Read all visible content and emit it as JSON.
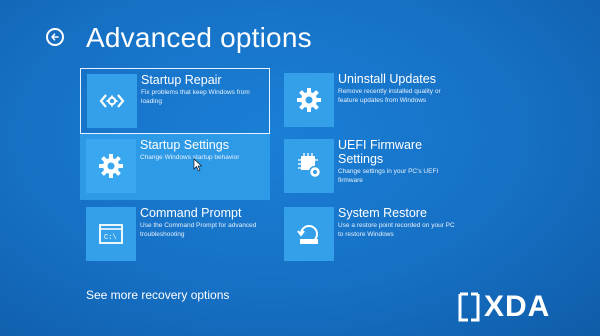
{
  "header": {
    "title": "Advanced options"
  },
  "options": [
    {
      "label": "Startup Repair",
      "desc": "Fix problems that keep Windows from loading",
      "icon": "code-brackets-icon"
    },
    {
      "label": "Uninstall Updates",
      "desc": "Remove recently installed quality or feature updates from Windows",
      "icon": "gear-icon"
    },
    {
      "label": "Startup Settings",
      "desc": "Change Windows startup behavior",
      "icon": "gear-icon"
    },
    {
      "label": "UEFI Firmware Settings",
      "desc": "Change settings in your PC's UEFI firmware",
      "icon": "chip-gear-icon"
    },
    {
      "label": "Command Prompt",
      "desc": "Use the Command Prompt for advanced troubleshooting",
      "icon": "terminal-icon"
    },
    {
      "label": "System Restore",
      "desc": "Use a restore point recorded on your PC to restore Windows",
      "icon": "restore-icon"
    }
  ],
  "footer": {
    "more_label": "See more recovery options"
  },
  "watermark": {
    "text": "XDA"
  },
  "colors": {
    "background": "#1670c4",
    "tile": "#34a0ea",
    "hover": "#2d9ae8"
  }
}
